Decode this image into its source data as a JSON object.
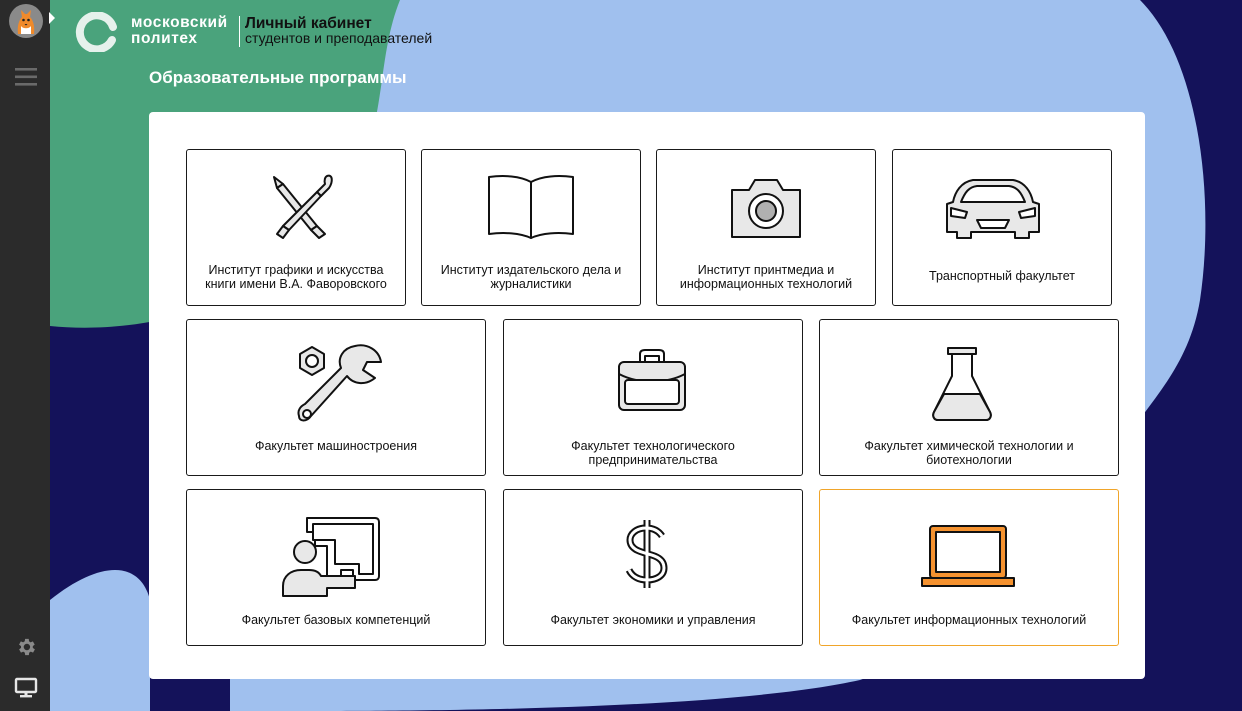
{
  "header": {
    "brand_line1": "московский",
    "brand_line2": "политех",
    "cabinet_title": "Личный кабинет",
    "cabinet_subtitle": "студентов и преподавателей"
  },
  "page": {
    "title": "Образовательные программы"
  },
  "sidebar": {
    "avatar_icon": "cat-avatar",
    "items": [
      {
        "icon": "hamburger-menu-icon"
      },
      {
        "icon": "gear-icon"
      },
      {
        "icon": "monitor-icon"
      }
    ]
  },
  "programs": [
    {
      "label": "Институт графики и искусства книги имени В.А. Фаворовского",
      "icon": "pencil-brush-icon"
    },
    {
      "label": "Институт издательского дела и журналистики",
      "icon": "open-book-icon"
    },
    {
      "label": "Институт принтмедиа и информационных технологий",
      "icon": "camera-icon"
    },
    {
      "label": "Транспортный факультет",
      "icon": "car-icon"
    },
    {
      "label": "Факультет машиностроения",
      "icon": "wrench-nut-icon"
    },
    {
      "label": "Факультет технологического предпринимательства",
      "icon": "briefcase-icon"
    },
    {
      "label": "Факультет химической технологии и биотехнологии",
      "icon": "flask-icon"
    },
    {
      "label": "Факультет базовых компетенций",
      "icon": "teacher-board-icon"
    },
    {
      "label": "Факультет экономики и управления",
      "icon": "dollar-icon"
    },
    {
      "label": "Факультет информационных технологий",
      "icon": "laptop-icon",
      "selected": true
    }
  ],
  "colors": {
    "background_navy": "#14125a",
    "blob_blue": "#a0c0ee",
    "blob_green": "#4aa37c",
    "sidebar": "#2b2b2b",
    "icon_fill": "#e8e8e8",
    "accent_orange": "#f5922f",
    "selected_border": "#f0a52a"
  }
}
